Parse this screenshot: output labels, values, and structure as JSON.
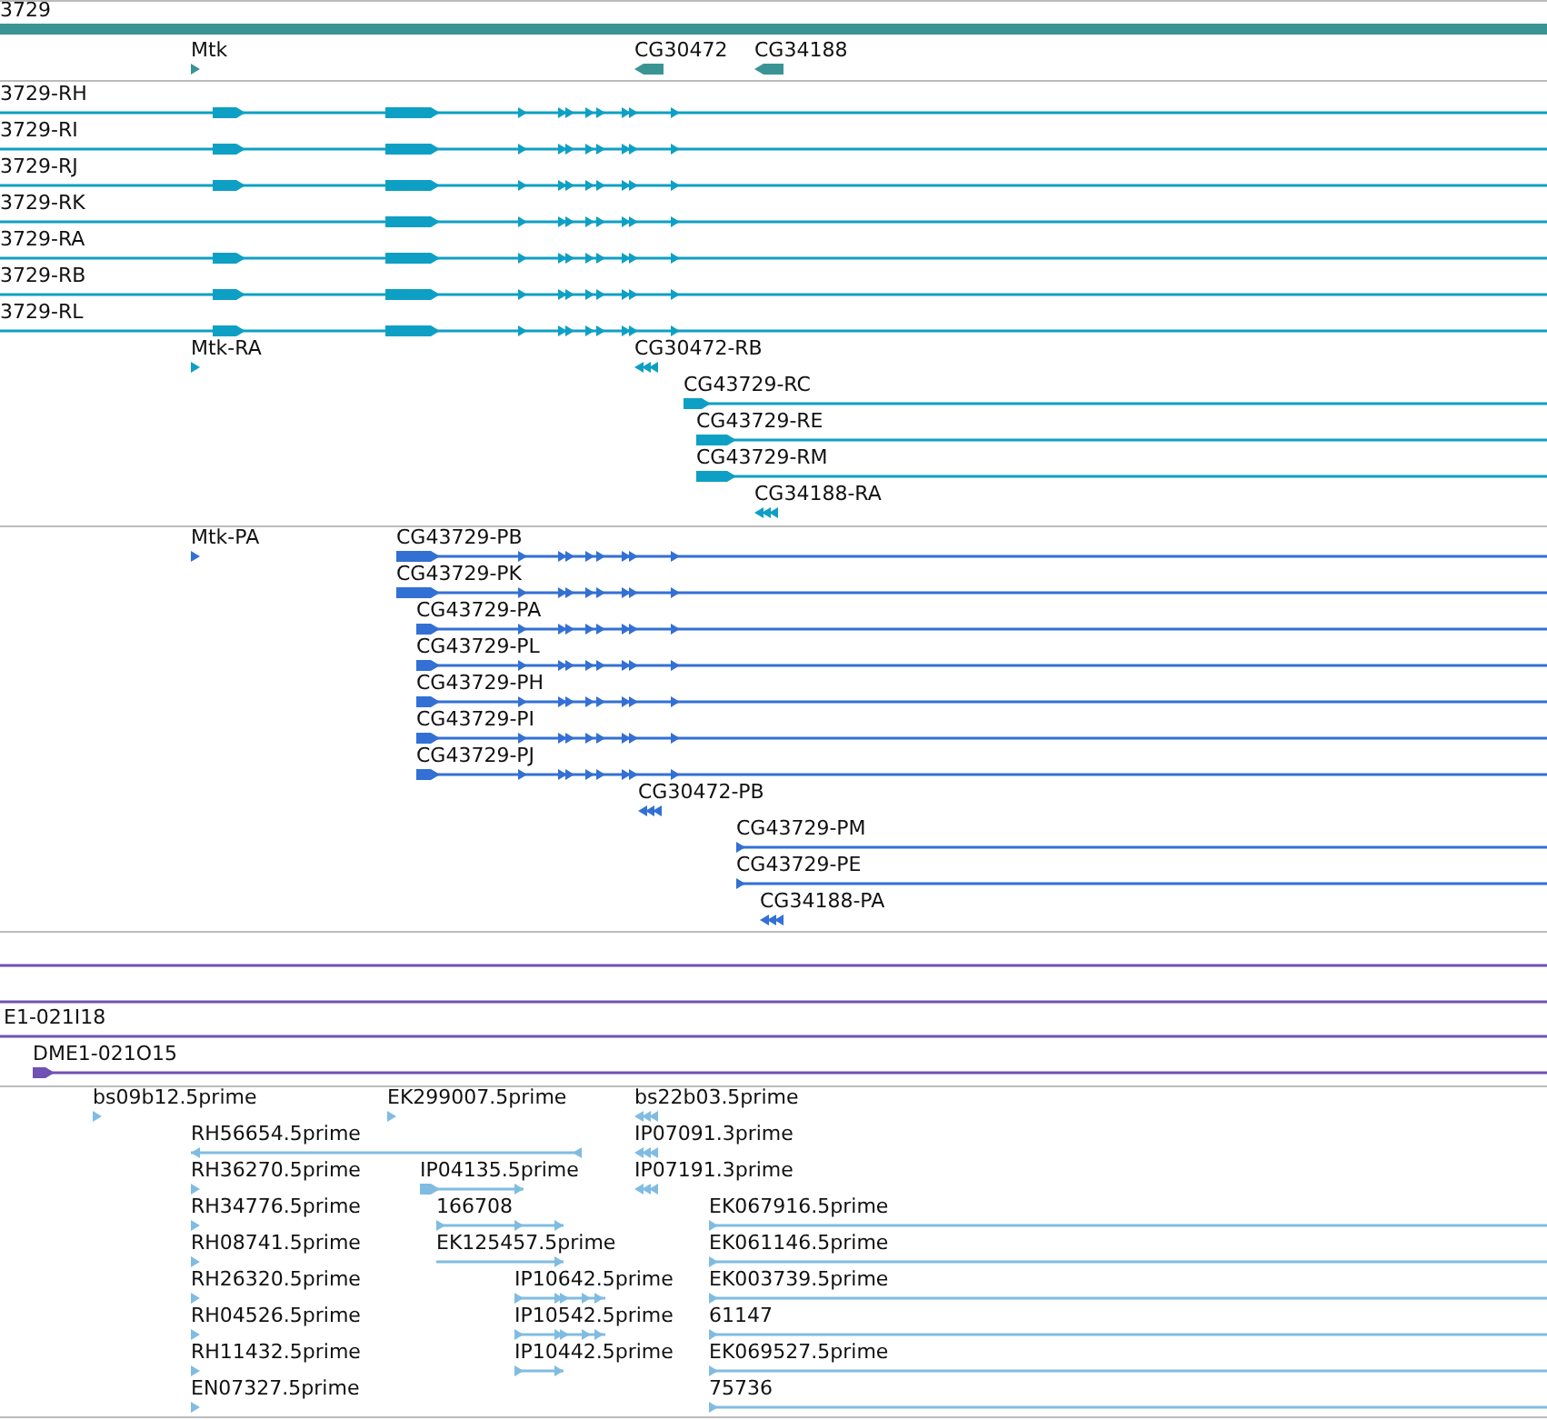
{
  "tracks": [
    {
      "kind": "gene",
      "color": "#3a9494",
      "features": [
        {
          "label": "3729",
          "reverse": false
        },
        {
          "label": "Mtk",
          "reverse": false
        },
        {
          "label": "CG30472",
          "reverse": true
        },
        {
          "label": "CG34188",
          "reverse": true
        }
      ]
    },
    {
      "kind": "transcript",
      "color": "#0ea0c4",
      "features": [
        {
          "label": "3729-RH",
          "reverse": false
        },
        {
          "label": "3729-RI",
          "reverse": false
        },
        {
          "label": "3729-RJ",
          "reverse": false
        },
        {
          "label": "3729-RK",
          "reverse": false
        },
        {
          "label": "3729-RA",
          "reverse": false
        },
        {
          "label": "3729-RB",
          "reverse": false
        },
        {
          "label": "3729-RL",
          "reverse": false
        },
        {
          "label": "Mtk-RA",
          "reverse": false
        },
        {
          "label": "CG30472-RB",
          "reverse": true
        },
        {
          "label": "CG43729-RC",
          "reverse": false
        },
        {
          "label": "CG43729-RE",
          "reverse": false
        },
        {
          "label": "CG43729-RM",
          "reverse": false
        },
        {
          "label": "CG34188-RA",
          "reverse": true
        }
      ]
    },
    {
      "kind": "protein",
      "color": "#3370d4",
      "features": [
        {
          "label": "Mtk-PA",
          "reverse": false
        },
        {
          "label": "CG43729-PB",
          "reverse": false
        },
        {
          "label": "CG43729-PK",
          "reverse": false
        },
        {
          "label": "CG43729-PA",
          "reverse": false
        },
        {
          "label": "CG43729-PL",
          "reverse": false
        },
        {
          "label": "CG43729-PH",
          "reverse": false
        },
        {
          "label": "CG43729-PI",
          "reverse": false
        },
        {
          "label": "CG43729-PJ",
          "reverse": false
        },
        {
          "label": "CG30472-PB",
          "reverse": true
        },
        {
          "label": "CG43729-PM",
          "reverse": false
        },
        {
          "label": "CG43729-PE",
          "reverse": false
        },
        {
          "label": "CG34188-PA",
          "reverse": true
        }
      ]
    },
    {
      "kind": "clone",
      "color": "#7052b4",
      "features": [
        {
          "label": "E1-021I18"
        },
        {
          "label": "DME1-021O15",
          "reverse": false
        }
      ]
    },
    {
      "kind": "est",
      "color": "#80bce2",
      "features": [
        {
          "label": "bs09b12.5prime",
          "reverse": false
        },
        {
          "label": "EK299007.5prime",
          "reverse": false
        },
        {
          "label": "bs22b03.5prime",
          "reverse": true
        },
        {
          "label": "RH56654.5prime",
          "reverse": true
        },
        {
          "label": "IP07091.3prime",
          "reverse": true
        },
        {
          "label": "RH36270.5prime",
          "reverse": false
        },
        {
          "label": "IP04135.5prime",
          "reverse": false
        },
        {
          "label": "IP07191.3prime",
          "reverse": true
        },
        {
          "label": "RH34776.5prime",
          "reverse": false
        },
        {
          "label": "166708",
          "reverse": false
        },
        {
          "label": "EK067916.5prime",
          "reverse": false
        },
        {
          "label": "RH08741.5prime",
          "reverse": false
        },
        {
          "label": "EK125457.5prime",
          "reverse": false
        },
        {
          "label": "EK061146.5prime",
          "reverse": false
        },
        {
          "label": "RH26320.5prime",
          "reverse": false
        },
        {
          "label": "IP10642.5prime",
          "reverse": false
        },
        {
          "label": "EK003739.5prime",
          "reverse": false
        },
        {
          "label": "RH04526.5prime",
          "reverse": false
        },
        {
          "label": "IP10542.5prime",
          "reverse": false
        },
        {
          "label": "61147",
          "reverse": false
        },
        {
          "label": "RH11432.5prime",
          "reverse": false
        },
        {
          "label": "IP10442.5prime",
          "reverse": false
        },
        {
          "label": "EK069527.5prime",
          "reverse": false
        },
        {
          "label": "EN07327.5prime",
          "reverse": false
        },
        {
          "label": "75736",
          "reverse": false
        }
      ]
    }
  ]
}
